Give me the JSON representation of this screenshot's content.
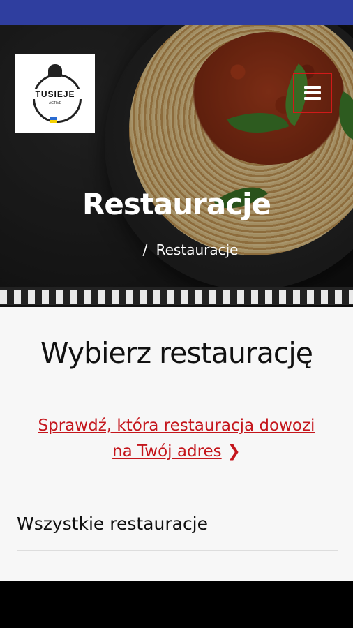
{
  "hero": {
    "title": "Restauracje",
    "breadcrumb": {
      "separator": "/",
      "current": "Restauracje"
    },
    "logo": {
      "name": "TUSIEJE",
      "sub": "ACTIVE"
    },
    "menu_icon": "hamburger-menu-icon"
  },
  "content": {
    "title": "Wybierz restaurację",
    "check_link": "Sprawdź, która restauracja dowozi na Twój adres",
    "check_link_icon": "chevron-right-icon",
    "section_title": "Wszystkie restauracje"
  },
  "colors": {
    "status_bar": "#2f3e9f",
    "accent_red": "#c4161c",
    "menu_border": "#d11a1a"
  }
}
